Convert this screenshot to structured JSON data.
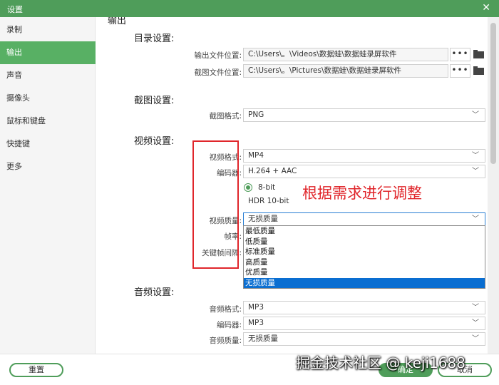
{
  "window": {
    "title": "设置",
    "close_glyph": "✕"
  },
  "sidebar": {
    "items": [
      {
        "label": "录制",
        "active": false
      },
      {
        "label": "输出",
        "active": true
      },
      {
        "label": "声音",
        "active": false
      },
      {
        "label": "摄像头",
        "active": false
      },
      {
        "label": "鼠标和键盘",
        "active": false
      },
      {
        "label": "快捷键",
        "active": false
      },
      {
        "label": "更多",
        "active": false
      }
    ]
  },
  "section_title": "输出",
  "directory": {
    "heading": "目录设置:",
    "output_label": "输出文件位置:",
    "output_path": "C:\\Users\\。\\Videos\\数据蛙\\数据蛙录屏软件",
    "screenshot_label": "截图文件位置:",
    "screenshot_path": "C:\\Users\\。\\Pictures\\数据蛙\\数据蛙录屏软件",
    "browse_glyph": "•••"
  },
  "screenshot": {
    "heading": "截图设置:",
    "format_label": "截图格式:",
    "format_value": "PNG"
  },
  "video": {
    "heading": "视频设置:",
    "format_label": "视频格式:",
    "format_value": "MP4",
    "encoder_label": "编码器:",
    "encoder_value": "H.264 + AAC",
    "bit_depth_options": [
      {
        "label": "8-bit",
        "selected": true
      },
      {
        "label": "HDR 10-bit",
        "selected": false
      }
    ],
    "quality_label": "视频质量:",
    "quality_value": "无损质量",
    "framerate_label": "帧率:",
    "keyframe_label": "关键帧间隔:",
    "quality_options": [
      "最低质量",
      "低质量",
      "标准质量",
      "高质量",
      "优质量",
      "无损质量"
    ],
    "quality_selected_index": 5
  },
  "audio": {
    "heading": "音频设置:",
    "format_label": "音频格式:",
    "format_value": "MP3",
    "encoder_label": "编码器:",
    "encoder_value": "MP3",
    "quality_label": "音频质量:",
    "quality_value": "无损质量"
  },
  "annotation": {
    "text": "根据需求进行调整",
    "color": "#e0262b"
  },
  "footer": {
    "reset_label": "重置",
    "ok_label": "确定",
    "cancel_label": "取消"
  },
  "watermark": "掘金技术社区 @ keji1688",
  "colors": {
    "accent": "#4f9d5a",
    "selection": "#0a6ed1"
  }
}
